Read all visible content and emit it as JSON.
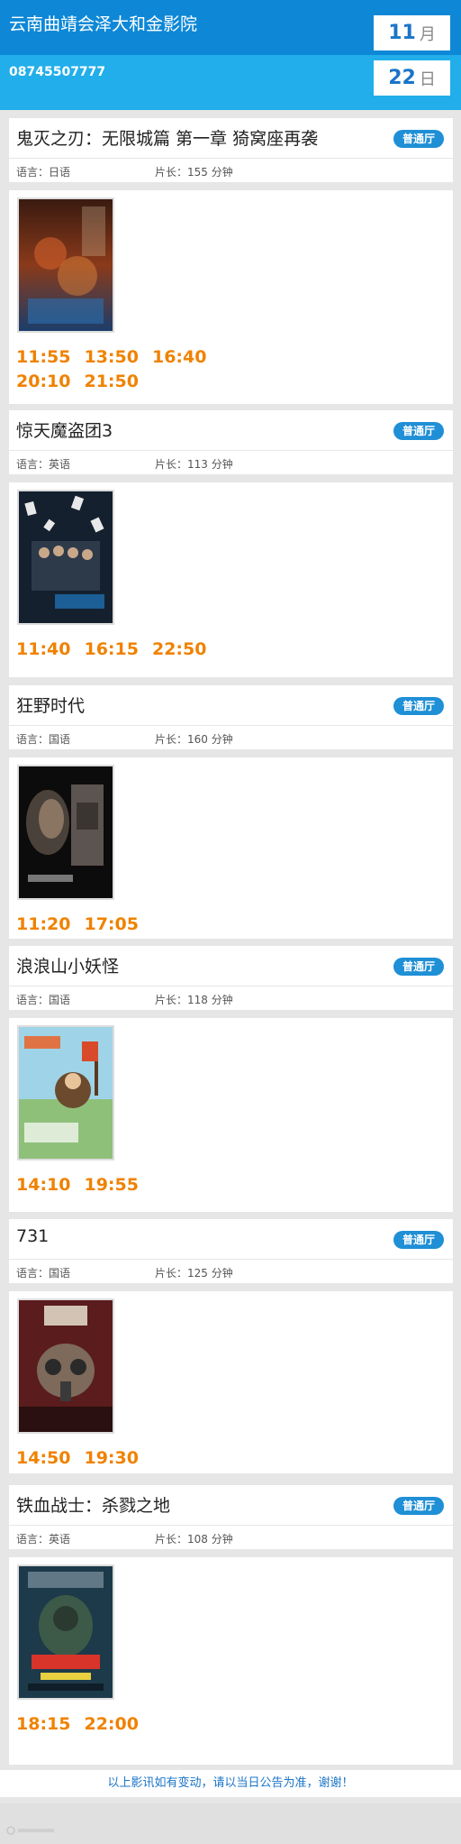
{
  "header": {
    "cinema_name": "云南曲靖会泽大和金影院",
    "phone": "08745507777",
    "month": "11",
    "month_unit": "月",
    "day": "22",
    "day_unit": "日"
  },
  "movies": [
    {
      "title": "鬼灭之刃：无限城篇 第一章 猗窝座再袭",
      "hall": "普通厅",
      "language": "语言：日语",
      "duration": "片长：155 分钟",
      "times": [
        "11:55",
        "13:50",
        "16:40",
        "20:10",
        "21:50"
      ]
    },
    {
      "title": "惊天魔盗团3",
      "hall": "普通厅",
      "language": "语言：英语",
      "duration": "片长：113 分钟",
      "times": [
        "11:40",
        "16:15",
        "22:50"
      ]
    },
    {
      "title": "狂野时代",
      "hall": "普通厅",
      "language": "语言：国语",
      "duration": "片长：160 分钟",
      "times": [
        "11:20",
        "17:05"
      ]
    },
    {
      "title": "浪浪山小妖怪",
      "hall": "普通厅",
      "language": "语言：国语",
      "duration": "片长：118 分钟",
      "times": [
        "14:10",
        "19:55"
      ]
    },
    {
      "title": "731",
      "hall": "普通厅",
      "language": "语言：国语",
      "duration": "片长：125 分钟",
      "times": [
        "14:50",
        "19:30"
      ]
    },
    {
      "title": "铁血战士：杀戮之地",
      "hall": "普通厅",
      "language": "语言：英语",
      "duration": "片长：108 分钟",
      "times": [
        "18:15",
        "22:00"
      ]
    }
  ],
  "footer": {
    "note": "以上影讯如有变动，请以当日公告为准，谢谢！"
  },
  "colors": {
    "header_dark": "#0e88d6",
    "header_light": "#22aeea",
    "time_orange": "#f08200",
    "badge_blue": "#1f8fd6"
  }
}
